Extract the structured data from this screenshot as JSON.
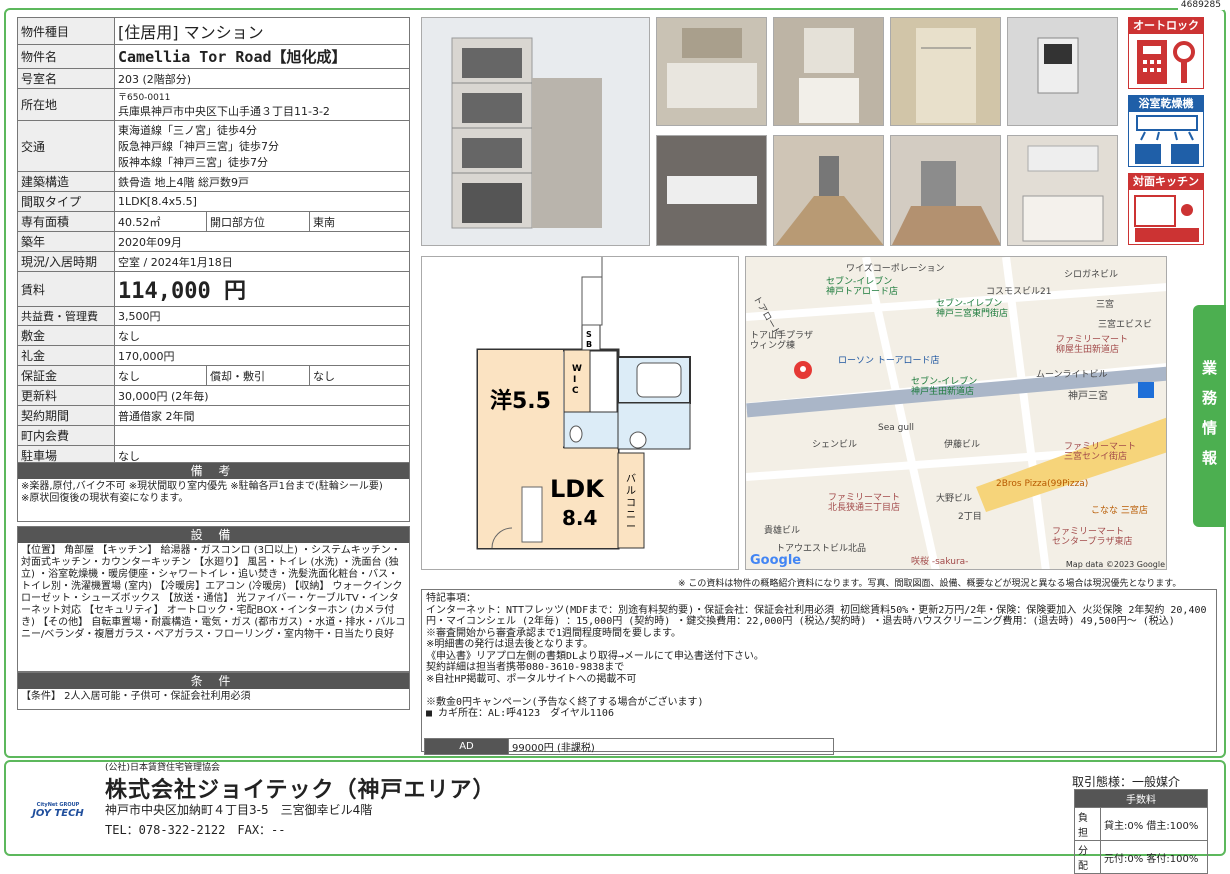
{
  "doc_id": "4689285",
  "spec": [
    {
      "k": "物件種目",
      "v": "[住居用] マンション"
    },
    {
      "k": "物件名",
      "v": "Camellia Tor Road【旭化成】"
    },
    {
      "k": "号室名",
      "v": "203 (2階部分)"
    },
    {
      "k": "所在地",
      "v1": "〒650-0011",
      "v2": "兵庫県神戸市中央区下山手通３丁目11-3-2"
    },
    {
      "k": "交通",
      "v1": "東海道線「三ノ宮」徒歩4分",
      "v2": "阪急神戸線「神戸三宮」徒歩7分",
      "v3": "阪神本線「神戸三宮」徒歩7分"
    },
    {
      "k": "建築構造",
      "v": "鉄骨造 地上4階 総戸数9戸"
    },
    {
      "k": "間取タイプ",
      "v": "1LDK[8.4x5.5]"
    },
    {
      "k": "専有面積",
      "v": "40.52㎡",
      "k2": "開口部方位",
      "v2": "東南"
    },
    {
      "k": "築年",
      "v": "2020年09月"
    },
    {
      "k": "現況/入居時期",
      "v": "空室 / 2024年1月18日"
    },
    {
      "k": "賃料",
      "v": "114,000 円"
    },
    {
      "k": "共益費・管理費",
      "v": "3,500円"
    },
    {
      "k": "敷金",
      "v": "なし"
    },
    {
      "k": "礼金",
      "v": "170,000円"
    },
    {
      "k": "保証金",
      "v": "なし",
      "k2": "償却・敷引",
      "v2": "なし"
    },
    {
      "k": "更新料",
      "v": "30,000円 (2年毎)"
    },
    {
      "k": "契約期間",
      "v": "普通借家 2年間"
    },
    {
      "k": "町内会費",
      "v": ""
    },
    {
      "k": "駐車場",
      "v": "なし"
    }
  ],
  "remarks": {
    "title": "備 考",
    "text": "※楽器,原付,バイク不可 ※現状間取り室内優先 ※駐輪各戸1台まで(駐輪シール要)\n※原状回復後の現状有姿になります。"
  },
  "equipment": {
    "title": "設 備",
    "text": "【位置】 角部屋 【キッチン】 給湯器・ガスコンロ (3口以上) ・システムキッチン・対面式キッチン・カウンターキッチン 【水廻り】 風呂・トイレ (水洗) ・洗面台 (独立) ・浴室乾燥機・暖房便座・シャワートイレ・追い焚き・洗髪洗面化粧台・バス・トイレ別・洗濯機置場 (室内) 【冷暖房】エアコン (冷暖房) 【収納】 ウォークインクローゼット・シューズボックス 【放送・通信】 光ファイバー・ケーブルTV・インターネット対応 【セキュリティ】 オートロック・宅配BOX・インターホン (カメラ付き) 【その他】 自転車置場・耐震構造・電気・ガス (都市ガス) ・水道・排水・バルコニー/ベランダ・複層ガラス・ペアガラス・フローリング・室内物干・日当たり良好"
  },
  "conditions": {
    "title": "条 件",
    "text": "【条件】 2人入居可能・子供可・保証会社利用必須"
  },
  "floorplan": {
    "room1": "洋5.5",
    "room2": "LDK",
    "room2_size": "8.4",
    "wic": "W\nI\nC",
    "sb": "S\nB",
    "balcony": "バルコニー"
  },
  "map_labels": [
    "ワイズコーポレーション",
    "シロガネビル",
    "コスモスビル21",
    "セブン-イレブン\n神戸トアロード店",
    "セブン-イレブン\n神戸三宮東門街店",
    "三宮",
    "三宮エビスビ",
    "ファミリーマート\n柳屋生田新道店",
    "ローソン トーアロード店",
    "セブン-イレブン\n神戸生田新道店",
    "ムーンライトビル",
    "神戸三宮",
    "Sea gull",
    "シェンビル",
    "伊藤ビル",
    "ファミリーマート\n三宮センイ街店",
    "2Bros Pizza(99Pizza)",
    "大野ビル",
    "こなな 三宮店",
    "ファミリーマート\n北長狭通三丁目店",
    "2丁目",
    "ファミリーマート\nセンタープラザ東店",
    "貴雄ビル",
    "トアウエストビル北品",
    "咲桜 -sakura-",
    "トアロード",
    "トア山手プラザ\nウィング棟",
    "Google",
    "Map data ©2023 Google"
  ],
  "badges": [
    "オートロック",
    "浴室乾燥機",
    "対面キッチン"
  ],
  "side_tab": "業\n務\n情\n報",
  "note": "※ この資料は物件の概略紹介資料になります。写真、間取図面、設備、概要などが現況と異なる場合は現況優先となります。",
  "special": "特記事項：\nインターネット：NTTフレッツ(MDFまで：別途有料契約要)・保証会社：保証会社利用必須 初回総賃料50%・更新2万円/2年・保険：保険要加入 火災保険 2年契約 20,400円・マイコンシェル (2年毎) ：15,000円 (契約時) ・鍵交換費用：22,000円 (税込/契約時) ・退去時ハウスクリーニング費用：(退去時) 49,500円～ (税込)\n※審査開始から審査承認まで1週間程度時間を要します。\n※明細書の発行は退去後となります。\n《申込書》リアプロ左側の書類DLより取得→メールにて申込書送付下さい。\n契約詳細は担当者携帯080-3610-9838まで\n※自社HP掲載可、ポータルサイトへの掲載不可\n\n※敷金0円キャンペーン(予告なく終了する場合がございます)\n■ カギ所在：AL:呼4123　ダイヤル1106",
  "ad": {
    "label": "AD",
    "value": "99000円 (非課税)"
  },
  "footer": {
    "assoc": "(公社)日本賃貸住宅管理協会",
    "company": "株式会社ジョイテック（神戸エリア）",
    "address": "神戸市中央区加納町４丁目3-5　三宮御幸ビル4階",
    "tel": "TEL：078-322-2122　FAX：--",
    "logo": "JOY TECH",
    "logo_sub": "CityNet GROUP",
    "deal": "取引態様：一般媒介",
    "fee_head": "手数料",
    "fee": [
      {
        "k": "負担",
        "v": "貸主:0% 借主:100%"
      },
      {
        "k": "分配",
        "v": "元付:0% 客付:100%"
      }
    ]
  },
  "colors": {
    "frame": "#5cb85c",
    "badge_red": "#c33",
    "badge_blue": "#1f5fa8",
    "header_dark": "#555"
  }
}
